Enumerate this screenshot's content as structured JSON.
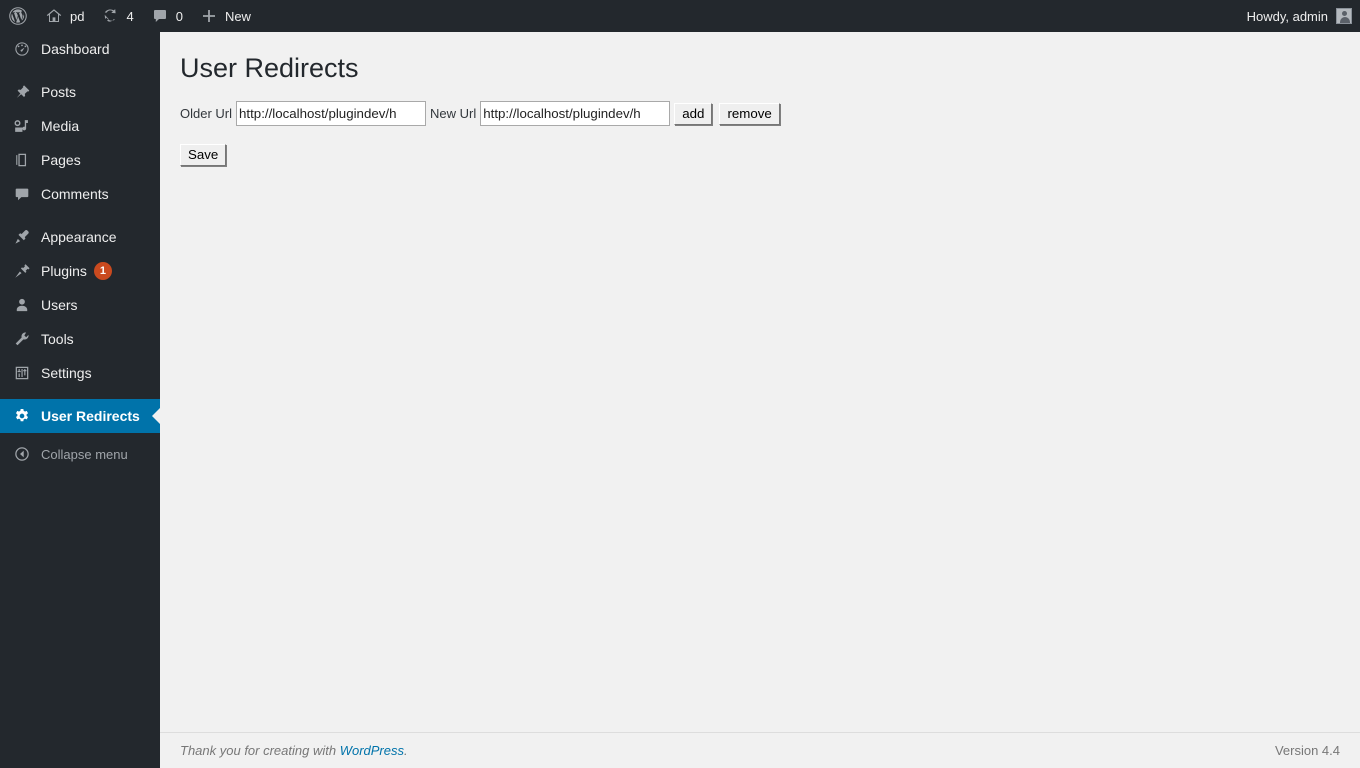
{
  "adminbar": {
    "items": [
      {
        "icon": "wordpress-logo-icon",
        "label": ""
      },
      {
        "icon": "home-icon",
        "label": "pd"
      },
      {
        "icon": "updates-icon",
        "label": "4"
      },
      {
        "icon": "comment-bubble-icon",
        "label": "0"
      },
      {
        "icon": "plus-icon",
        "label": "New"
      }
    ],
    "wordpress_logo_label": "",
    "site_name": "pd",
    "updates_count": "4",
    "comments_count": "0",
    "new_label": "New",
    "howdy": "Howdy, admin"
  },
  "sidebar": {
    "items": [
      {
        "label": "Dashboard",
        "icon": "dashboard-icon",
        "current": false,
        "badge": ""
      },
      {
        "label": "Posts",
        "icon": "pin-icon",
        "current": false,
        "badge": ""
      },
      {
        "label": "Media",
        "icon": "media-icon",
        "current": false,
        "badge": ""
      },
      {
        "label": "Pages",
        "icon": "pages-icon",
        "current": false,
        "badge": ""
      },
      {
        "label": "Comments",
        "icon": "comment-bubble-icon",
        "current": false,
        "badge": ""
      },
      {
        "label": "Appearance",
        "icon": "paintbrush-icon",
        "current": false,
        "badge": ""
      },
      {
        "label": "Plugins",
        "icon": "plug-icon",
        "current": false,
        "badge": "1"
      },
      {
        "label": "Users",
        "icon": "user-icon",
        "current": false,
        "badge": ""
      },
      {
        "label": "Tools",
        "icon": "wrench-icon",
        "current": false,
        "badge": ""
      },
      {
        "label": "Settings",
        "icon": "sliders-icon",
        "current": false,
        "badge": ""
      },
      {
        "label": "User Redirects",
        "icon": "gear-icon",
        "current": true,
        "badge": ""
      }
    ],
    "collapse_label": "Collapse menu",
    "accent_color": "#0073aa",
    "badge_color": "#ca4a1f",
    "background_color": "#23282d"
  },
  "main": {
    "page_title": "User Redirects",
    "form": {
      "older_url_label": "Older Url",
      "older_url_value": "http://localhost/plugindev/h",
      "older_url_placeholder": "",
      "new_url_label": "New Url",
      "new_url_value": "http://localhost/plugindev/h",
      "new_url_placeholder": "",
      "add_label": "add",
      "remove_label": "remove",
      "save_label": "Save"
    }
  },
  "footer": {
    "thanks_prefix": "Thank you for creating with ",
    "wordpress_link": "WordPress",
    "thanks_suffix": ".",
    "version": "Version 4.4"
  }
}
